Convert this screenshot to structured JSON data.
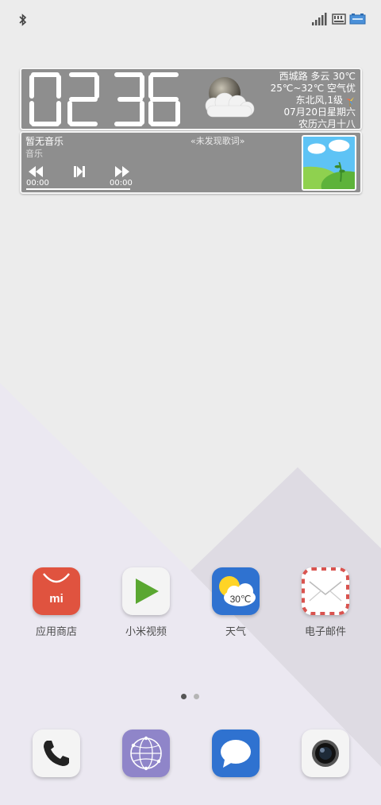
{
  "status_bar": {
    "icons": [
      "bluetooth-icon",
      "signal-icon",
      "sim-icon",
      "battery-icon"
    ]
  },
  "widget": {
    "clock": {
      "hours": "02",
      "minutes": "36"
    },
    "weather": {
      "location_line": "西城路 多云 30℃",
      "range_line": "25℃~32℃ 空气优",
      "wind_line": "东北风,1级",
      "date_line": "07月20日星期六",
      "lunar_line": "农历六月十八",
      "icon": "cloud-moon-icon"
    },
    "music": {
      "title": "暂无音乐",
      "artist": "音乐",
      "lyrics": "«未发现歌词»",
      "time_start": "00:00",
      "time_end": "00:00",
      "progress": 0
    }
  },
  "apps": [
    {
      "label": "应用商店",
      "icon": "app-store-icon"
    },
    {
      "label": "小米视频",
      "icon": "video-play-icon"
    },
    {
      "label": "天气",
      "icon": "weather-icon",
      "badge": "30℃"
    },
    {
      "label": "电子邮件",
      "icon": "mail-icon"
    }
  ],
  "dock": [
    {
      "icon": "phone-icon"
    },
    {
      "icon": "browser-icon"
    },
    {
      "icon": "messages-icon"
    },
    {
      "icon": "camera-icon"
    }
  ],
  "pager": {
    "pages": 2,
    "current": 1
  },
  "colors": {
    "background": "#ececec",
    "widget": "#8e8e8e",
    "app_store": "#e0533f",
    "weather_app": "#2f72d0",
    "messages": "#2f72d0",
    "browser": "#8f85c9"
  }
}
